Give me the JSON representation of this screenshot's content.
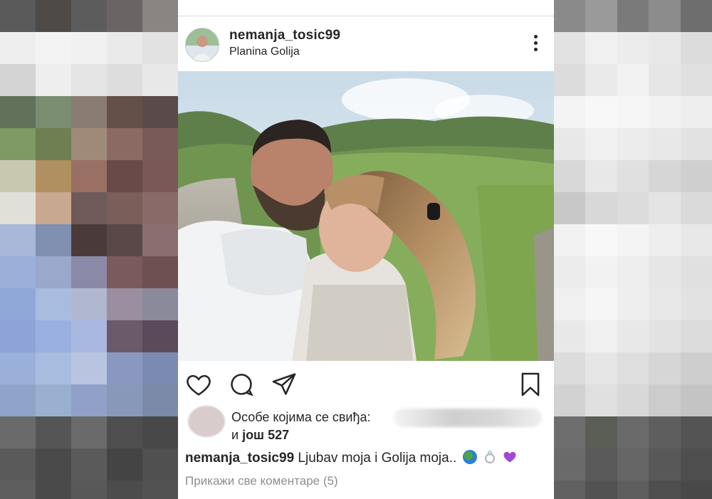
{
  "post": {
    "username": "nemanja_tosic99",
    "location": "Planina Golija",
    "caption_user": "nemanja_tosic99",
    "caption_text": "Ljubav moja i Golija moja..",
    "caption_emojis": [
      "globe-emoji",
      "ring-emoji",
      "purple-heart-emoji"
    ]
  },
  "likes": {
    "label": "Особе којима се свиђа:",
    "and": "и ",
    "more": "још 527"
  },
  "comments": {
    "view_all": "Прикажи све коментаре (5)"
  },
  "icons": {
    "like": "heart-icon",
    "comment": "comment-icon",
    "share": "share-icon",
    "save": "bookmark-icon",
    "more": "more-options-icon"
  },
  "colors": {
    "text": "#262626",
    "muted": "#8e8e8e",
    "divider": "#dbdbdb"
  }
}
